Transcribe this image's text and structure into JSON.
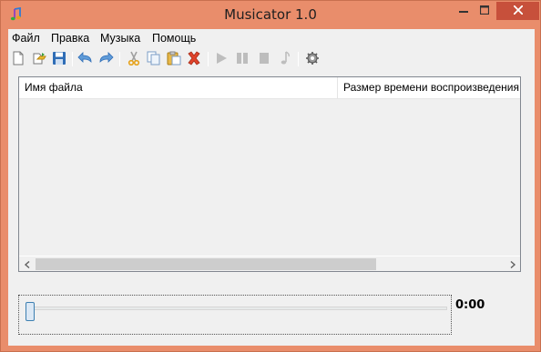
{
  "window": {
    "title": "Musicator 1.0",
    "icon": "music-note-icon"
  },
  "titlebar_buttons": {
    "minimize": "minimize-icon",
    "maximize": "maximize-icon",
    "close": "close-icon"
  },
  "menu": {
    "items": [
      "Файл",
      "Правка",
      "Музыка",
      "Помощь"
    ]
  },
  "toolbar": {
    "buttons": [
      {
        "name": "new-file",
        "icon": "new-document-icon"
      },
      {
        "name": "open-file",
        "icon": "open-folder-icon"
      },
      {
        "name": "save-file",
        "icon": "floppy-disk-icon"
      },
      {
        "name": "undo",
        "icon": "undo-arrow-icon"
      },
      {
        "name": "redo",
        "icon": "redo-arrow-icon"
      },
      {
        "name": "cut",
        "icon": "scissors-icon"
      },
      {
        "name": "copy",
        "icon": "copy-icon"
      },
      {
        "name": "paste",
        "icon": "paste-icon"
      },
      {
        "name": "delete",
        "icon": "red-x-icon"
      },
      {
        "name": "play",
        "icon": "play-icon"
      },
      {
        "name": "pause",
        "icon": "pause-icon"
      },
      {
        "name": "stop",
        "icon": "stop-icon"
      },
      {
        "name": "music",
        "icon": "music-note-icon"
      },
      {
        "name": "settings",
        "icon": "gear-icon"
      }
    ]
  },
  "listview": {
    "columns": [
      "Имя файла",
      "Размер времени воспроизведения"
    ],
    "rows": []
  },
  "player": {
    "position_fraction": 0.0,
    "time": "0:00"
  },
  "colors": {
    "frame": "#e98d6b",
    "close_button": "#c7503b",
    "client": "#f0f0f0"
  }
}
